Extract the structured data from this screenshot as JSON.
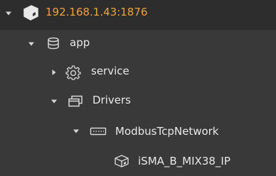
{
  "colors": {
    "background": "#393939",
    "selected_row": "#2d2d2d",
    "root_label": "#f0a23a",
    "text": "#e8e8e8",
    "icon": "#d6d6d6"
  },
  "tree": {
    "root": {
      "label": "192.168.1.43:1876",
      "icon": "cube-icon",
      "expanded": true
    },
    "app": {
      "label": "app",
      "icon": "database-icon",
      "expanded": true
    },
    "service": {
      "label": "service",
      "icon": "gear-icon",
      "expanded": false
    },
    "drivers": {
      "label": "Drivers",
      "icon": "windows-stack-icon",
      "expanded": true
    },
    "network": {
      "label": "ModbusTcpNetwork",
      "icon": "network-port-icon",
      "expanded": true
    },
    "device": {
      "label": "iSMA_B_MIX38_IP",
      "icon": "device-cube-icon"
    }
  }
}
